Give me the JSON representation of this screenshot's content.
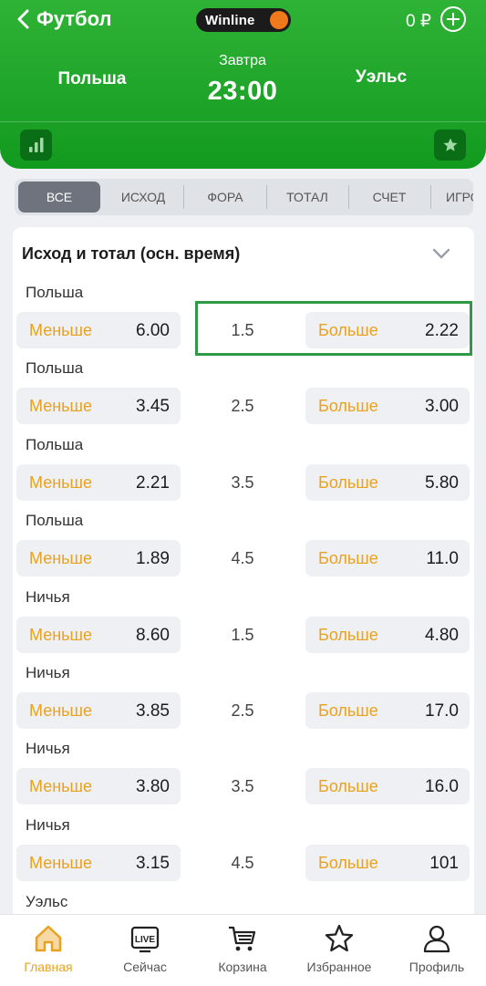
{
  "header": {
    "back_label": "Футбол",
    "brand": "Winline",
    "balance": "0 ₽",
    "team_home": "Польша",
    "team_away": "Уэльс",
    "day": "Завтра",
    "time": "23:00"
  },
  "tabs": [
    "ВСЕ",
    "ИСХОД",
    "ФОРА",
    "ТОТАЛ",
    "СЧЕТ",
    "ИГРО"
  ],
  "market": {
    "title": "Исход и тотал (осн. время)",
    "rows": [
      {
        "label": "Польша",
        "under_label": "Меньше",
        "under": "6.00",
        "line": "1.5",
        "over_label": "Больше",
        "over": "2.22"
      },
      {
        "label": "Польша",
        "under_label": "Меньше",
        "under": "3.45",
        "line": "2.5",
        "over_label": "Больше",
        "over": "3.00"
      },
      {
        "label": "Польша",
        "under_label": "Меньше",
        "under": "2.21",
        "line": "3.5",
        "over_label": "Больше",
        "over": "5.80"
      },
      {
        "label": "Польша",
        "under_label": "Меньше",
        "under": "1.89",
        "line": "4.5",
        "over_label": "Больше",
        "over": "11.0"
      },
      {
        "label": "Ничья",
        "under_label": "Меньше",
        "under": "8.60",
        "line": "1.5",
        "over_label": "Больше",
        "over": "4.80"
      },
      {
        "label": "Ничья",
        "under_label": "Меньше",
        "under": "3.85",
        "line": "2.5",
        "over_label": "Больше",
        "over": "17.0"
      },
      {
        "label": "Ничья",
        "under_label": "Меньше",
        "under": "3.80",
        "line": "3.5",
        "over_label": "Больше",
        "over": "16.0"
      },
      {
        "label": "Ничья",
        "under_label": "Меньше",
        "under": "3.15",
        "line": "4.5",
        "over_label": "Больше",
        "over": "101"
      }
    ],
    "next_label": "Уэльс"
  },
  "bottom_nav": [
    {
      "label": "Главная",
      "icon": "home-icon",
      "active": true
    },
    {
      "label": "Сейчас",
      "icon": "live-icon",
      "active": false
    },
    {
      "label": "Корзина",
      "icon": "cart-icon",
      "active": false
    },
    {
      "label": "Избранное",
      "icon": "star-icon",
      "active": false
    },
    {
      "label": "Профиль",
      "icon": "profile-icon",
      "active": false
    }
  ],
  "colors": {
    "brand_green": "#1fa52a",
    "accent_orange": "#e9a21f",
    "highlight_green": "#2e9a45"
  }
}
